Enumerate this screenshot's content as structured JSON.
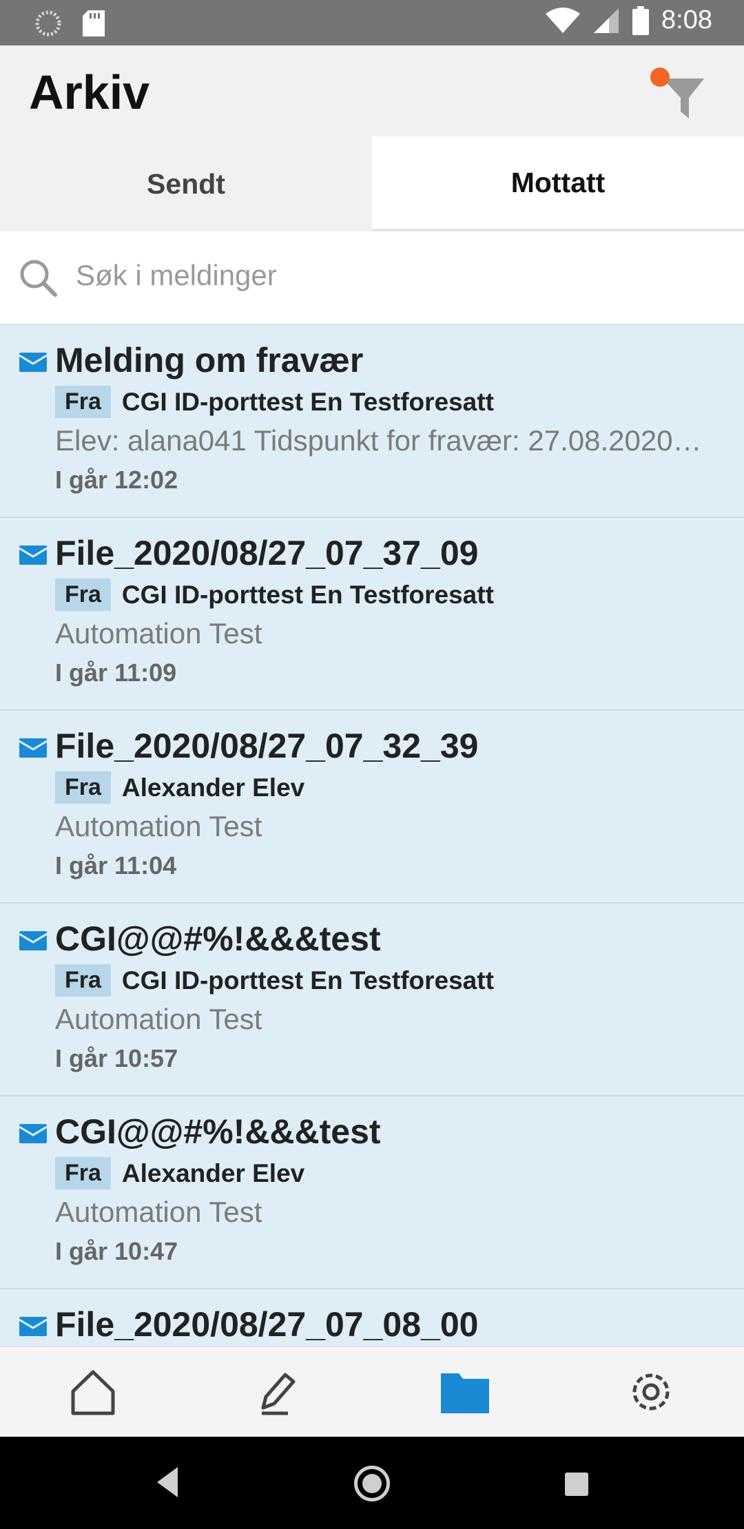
{
  "status_bar": {
    "time": "8:08"
  },
  "header": {
    "title": "Arkiv"
  },
  "tabs": [
    {
      "label": "Sendt"
    },
    {
      "label": "Mottatt"
    }
  ],
  "search": {
    "placeholder": "Søk i meldinger"
  },
  "messages": [
    {
      "subject": "Melding om fravær",
      "from_label": "Fra",
      "sender": "CGI ID-porttest En Testforesatt",
      "preview": "Elev: alana041   Tidspunkt for fravær: 27.08.2020…",
      "time": "I går 12:02"
    },
    {
      "subject": "File_2020/08/27_07_37_09",
      "from_label": "Fra",
      "sender": "CGI ID-porttest En Testforesatt",
      "preview": "Automation Test",
      "time": "I går 11:09"
    },
    {
      "subject": "File_2020/08/27_07_32_39",
      "from_label": "Fra",
      "sender": "Alexander Elev",
      "preview": "Automation Test",
      "time": "I går 11:04"
    },
    {
      "subject": "CGI@@#%!&&&test",
      "from_label": "Fra",
      "sender": "CGI ID-porttest En Testforesatt",
      "preview": "Automation Test",
      "time": "I går 10:57"
    },
    {
      "subject": "CGI@@#%!&&&test",
      "from_label": "Fra",
      "sender": "Alexander Elev",
      "preview": "Automation Test",
      "time": "I går 10:47"
    },
    {
      "subject": "File_2020/08/27_07_08_00",
      "from_label": "",
      "sender": "",
      "preview": "",
      "time": ""
    }
  ],
  "colors": {
    "accent": "#1a8ad4",
    "badge": "#f26522",
    "unread_row": "#dfedf6"
  },
  "bottom_nav": {
    "icons": [
      "home-icon",
      "compose-icon",
      "folder-icon",
      "settings-icon"
    ],
    "active": "folder-icon"
  }
}
